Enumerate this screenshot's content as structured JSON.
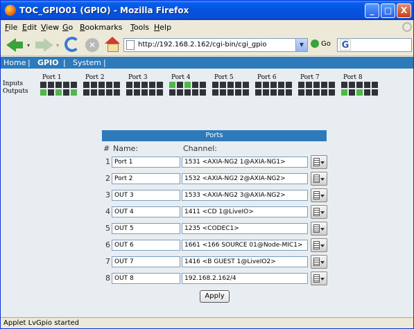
{
  "window": {
    "title": "TOC_GPIO01 (GPIO) - Mozilla Firefox",
    "controls": {
      "minimize": "_",
      "maximize": "□",
      "close": "X"
    }
  },
  "menubar": {
    "items": [
      {
        "pre": "",
        "u": "F",
        "post": "ile"
      },
      {
        "pre": "",
        "u": "E",
        "post": "dit"
      },
      {
        "pre": "",
        "u": "V",
        "post": "iew"
      },
      {
        "pre": "",
        "u": "G",
        "post": "o"
      },
      {
        "pre": "",
        "u": "B",
        "post": "ookmarks"
      },
      {
        "pre": "",
        "u": "T",
        "post": "ools"
      },
      {
        "pre": "",
        "u": "H",
        "post": "elp"
      }
    ]
  },
  "toolbar": {
    "url": "http://192.168.2.162/cgi-bin/cgi_gpio",
    "go_label": "Go",
    "stop_glyph": "✕",
    "url_dropdown": "▼",
    "search_logo": "G",
    "back_dropdown": "▾",
    "fwd_dropdown": "▾"
  },
  "appnav": {
    "items": [
      "Home",
      "GPIO",
      "System"
    ],
    "separator": "|",
    "active": "GPIO"
  },
  "gpio": {
    "ports": [
      "Port 1",
      "Port 2",
      "Port 3",
      "Port 4",
      "Port 5",
      "Port 6",
      "Port 7",
      "Port 8"
    ],
    "inputs_label": "Inputs",
    "outputs_label": "Outputs",
    "inputs_state": [
      [
        0,
        0,
        0,
        0,
        0
      ],
      [
        0,
        0,
        0,
        0,
        0
      ],
      [
        0,
        0,
        0,
        0,
        0
      ],
      [
        1,
        0,
        1,
        0,
        0
      ],
      [
        0,
        0,
        0,
        0,
        0
      ],
      [
        0,
        0,
        0,
        0,
        0
      ],
      [
        0,
        0,
        0,
        0,
        0
      ],
      [
        0,
        0,
        0,
        0,
        0
      ]
    ],
    "outputs_state": [
      [
        1,
        0,
        1,
        0,
        1
      ],
      [
        0,
        0,
        0,
        0,
        0
      ],
      [
        0,
        0,
        0,
        0,
        0
      ],
      [
        0,
        0,
        0,
        0,
        0
      ],
      [
        0,
        0,
        0,
        0,
        0
      ],
      [
        0,
        0,
        0,
        0,
        0
      ],
      [
        0,
        0,
        0,
        0,
        0
      ],
      [
        1,
        0,
        1,
        0,
        0
      ]
    ],
    "colors": {
      "on": "#4fb748",
      "off": "#2f3338"
    }
  },
  "ports_table": {
    "title": "Ports",
    "col_num": "#",
    "col_name": "Name:",
    "col_channel": "Channel:",
    "rows": [
      {
        "num": "1",
        "name": "Port 1",
        "channel": "1531 <AXIA-NG2 1@AXIA-NG1>"
      },
      {
        "num": "2",
        "name": "Port 2",
        "channel": "1532 <AXIA-NG2 2@AXIA-NG2>"
      },
      {
        "num": "3",
        "name": "OUT 3",
        "channel": "1533 <AXIA-NG2 3@AXIA-NG2>"
      },
      {
        "num": "4",
        "name": "OUT 4",
        "channel": "1411 <CD 1@LiveIO>"
      },
      {
        "num": "5",
        "name": "OUT 5",
        "channel": "1235 <CODEC1>"
      },
      {
        "num": "6",
        "name": "OUT 6",
        "channel": "1661 <166 SOURCE 01@Node-MIC1>"
      },
      {
        "num": "7",
        "name": "OUT 7",
        "channel": "1416 <B GUEST 1@LiveIO2>"
      },
      {
        "num": "8",
        "name": "OUT 8",
        "channel": "192.168.2.162/4"
      }
    ],
    "apply_label": "Apply"
  },
  "status": {
    "text": "Applet LvGpio started"
  },
  "colors": {
    "nav_bar": "#2e79b9",
    "xp_title": "#0553e0"
  }
}
